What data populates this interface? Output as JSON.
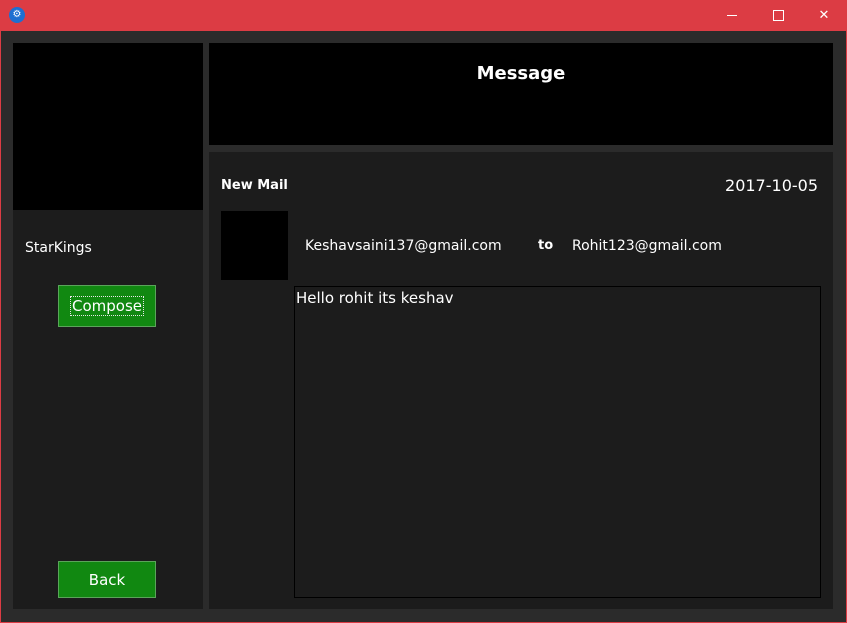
{
  "titlebar": {
    "app_icon": "app-logo-icon",
    "minimize_icon": "minimize-icon",
    "maximize_icon": "maximize-icon",
    "close_icon": "close-icon",
    "accent_color": "#dc3c44"
  },
  "sidebar": {
    "username": "StarKings",
    "compose_label": "Compose",
    "back_label": "Back",
    "button_color": "#118811"
  },
  "header": {
    "title": "Message"
  },
  "mail": {
    "type": "New Mail",
    "date": "2017-10-05",
    "from": "Keshavsaini137@gmail.com",
    "to_label": "to",
    "to": "Rohit123@gmail.com",
    "body": "Hello rohit its keshav"
  }
}
